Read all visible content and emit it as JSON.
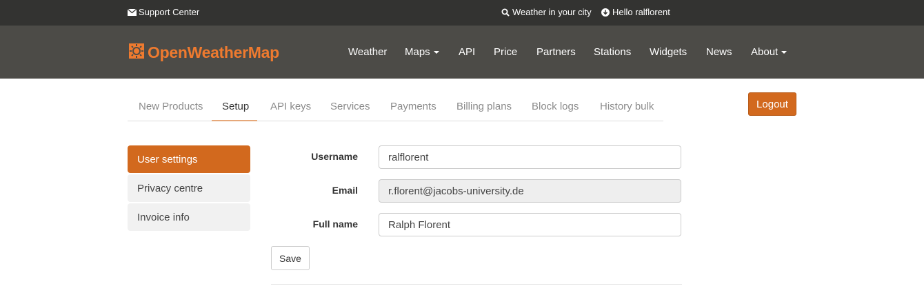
{
  "topbar": {
    "support_label": "Support Center",
    "weather_label": "Weather in your city",
    "hello_label": "Hello ralflorent"
  },
  "navbar": {
    "logo_text": "OpenWeatherMap",
    "items": [
      {
        "label": "Weather",
        "dropdown": false
      },
      {
        "label": "Maps",
        "dropdown": true
      },
      {
        "label": "API",
        "dropdown": false
      },
      {
        "label": "Price",
        "dropdown": false
      },
      {
        "label": "Partners",
        "dropdown": false
      },
      {
        "label": "Stations",
        "dropdown": false
      },
      {
        "label": "Widgets",
        "dropdown": false
      },
      {
        "label": "News",
        "dropdown": false
      },
      {
        "label": "About",
        "dropdown": true
      }
    ]
  },
  "tabs": [
    {
      "label": "New Products",
      "active": false
    },
    {
      "label": "Setup",
      "active": true
    },
    {
      "label": "API keys",
      "active": false
    },
    {
      "label": "Services",
      "active": false
    },
    {
      "label": "Payments",
      "active": false
    },
    {
      "label": "Billing plans",
      "active": false
    },
    {
      "label": "Block logs",
      "active": false
    },
    {
      "label": "History bulk",
      "active": false
    }
  ],
  "logout_label": "Logout",
  "sidebar": {
    "items": [
      {
        "label": "User settings",
        "active": true
      },
      {
        "label": "Privacy centre",
        "active": false
      },
      {
        "label": "Invoice info",
        "active": false
      }
    ]
  },
  "form": {
    "username_label": "Username",
    "username_value": "ralflorent",
    "email_label": "Email",
    "email_value": "r.florent@jacobs-university.de",
    "fullname_label": "Full name",
    "fullname_value": "Ralph Florent",
    "save_label": "Save"
  },
  "colors": {
    "accent": "#d2691e",
    "topbar_bg": "#333331",
    "navbar_bg": "#4c4b47",
    "logo": "#ee7a2f"
  },
  "icons": {
    "support": "envelope-icon",
    "weather": "search-icon",
    "hello": "arrow-circle-down-icon",
    "logo": "sun-icon"
  }
}
